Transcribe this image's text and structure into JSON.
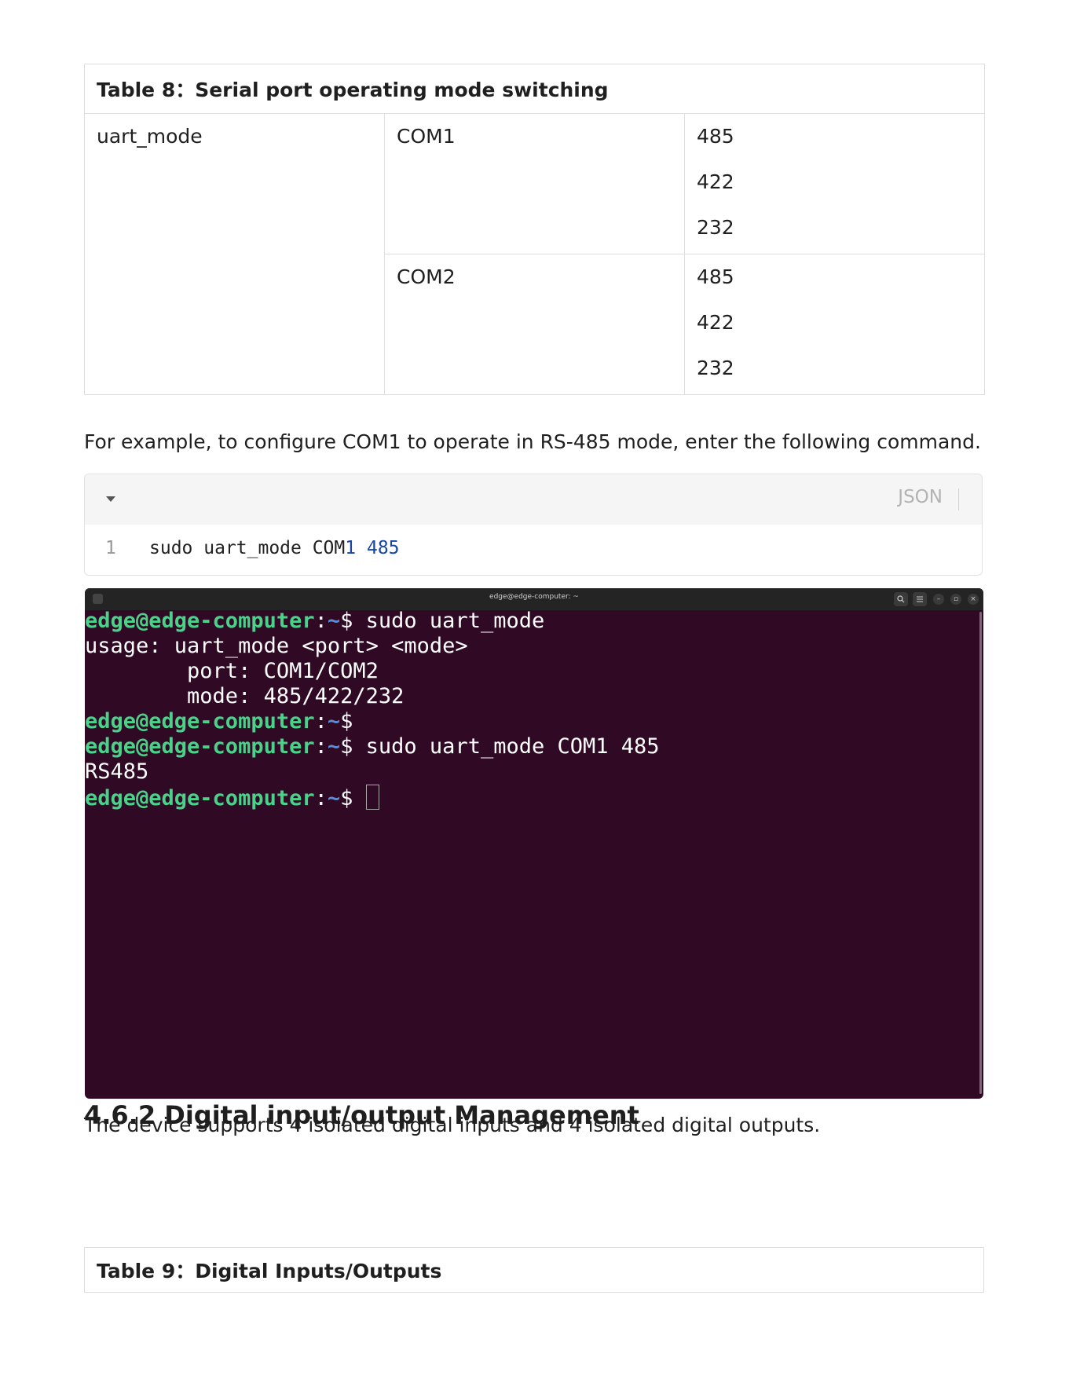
{
  "table8": {
    "caption": "Table 8：Serial port operating mode switching",
    "command": "uart_mode",
    "ports": [
      {
        "name": "COM1",
        "modes": [
          "485",
          "422",
          "232"
        ]
      },
      {
        "name": "COM2",
        "modes": [
          "485",
          "422",
          "232"
        ]
      }
    ]
  },
  "example_text": "For example, to configure COM1 to operate in RS‑485 mode, enter the following command.",
  "code_block": {
    "language": "JSON",
    "line_number": "1",
    "code_text": "sudo uart_mode COM",
    "code_num1": "1",
    "code_num2": "485"
  },
  "terminal": {
    "title": "edge@edge-computer: ~",
    "user_host": "edge@edge-computer",
    "colon": ":",
    "tilde": "~",
    "lines": [
      {
        "type": "prompt",
        "cmd": "$ sudo uart_mode"
      },
      {
        "type": "out",
        "text": "usage: uart_mode <port> <mode>"
      },
      {
        "type": "out",
        "text": "        port: COM1/COM2"
      },
      {
        "type": "out",
        "text": "        mode: 485/422/232"
      },
      {
        "type": "prompt",
        "cmd": "$"
      },
      {
        "type": "prompt",
        "cmd": "$ sudo uart_mode COM1 485"
      },
      {
        "type": "out",
        "text": "RS485"
      },
      {
        "type": "prompt",
        "cmd": "$ "
      }
    ]
  },
  "section_heading": "4.6.2 Digital input/output Management",
  "digital_text": "The device supports 4 isolated digital inputs and 4 isolated digital outputs.",
  "table9": {
    "caption": "Table 9：Digital Inputs/Outputs"
  }
}
